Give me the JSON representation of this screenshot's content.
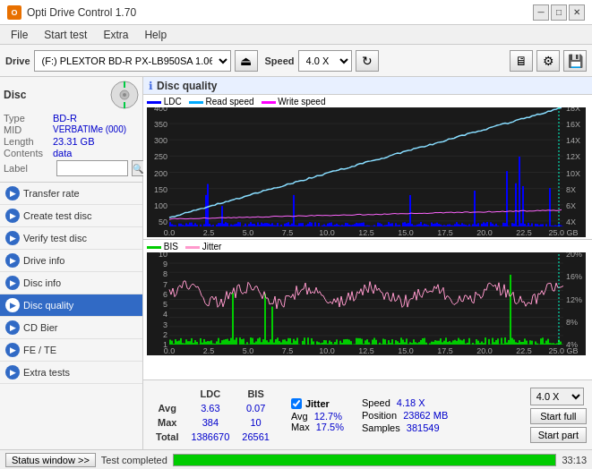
{
  "titleBar": {
    "icon": "O",
    "title": "Opti Drive Control 1.70",
    "minimize": "─",
    "maximize": "□",
    "close": "✕"
  },
  "menuBar": {
    "items": [
      "File",
      "Start test",
      "Extra",
      "Help"
    ]
  },
  "toolbar": {
    "driveLabel": "Drive",
    "driveValue": "(F:)  PLEXTOR BD-R  PX-LB950SA 1.06",
    "speedLabel": "Speed",
    "speedValue": "4.0 X"
  },
  "disc": {
    "title": "Disc",
    "type": {
      "key": "Type",
      "value": "BD-R"
    },
    "mid": {
      "key": "MID",
      "value": "VERBATIMe (000)"
    },
    "length": {
      "key": "Length",
      "value": "23.31 GB"
    },
    "contents": {
      "key": "Contents",
      "value": "data"
    },
    "label": {
      "key": "Label",
      "value": ""
    }
  },
  "navItems": [
    {
      "id": "transfer-rate",
      "label": "Transfer rate",
      "active": false
    },
    {
      "id": "create-test-disc",
      "label": "Create test disc",
      "active": false
    },
    {
      "id": "verify-test-disc",
      "label": "Verify test disc",
      "active": false
    },
    {
      "id": "drive-info",
      "label": "Drive info",
      "active": false
    },
    {
      "id": "disc-info",
      "label": "Disc info",
      "active": false
    },
    {
      "id": "disc-quality",
      "label": "Disc quality",
      "active": true
    },
    {
      "id": "cd-bier",
      "label": "CD Bier",
      "active": false
    },
    {
      "id": "fe-te",
      "label": "FE / TE",
      "active": false
    },
    {
      "id": "extra-tests",
      "label": "Extra tests",
      "active": false
    }
  ],
  "chartTitle": "Disc quality",
  "legend1": {
    "ldc": "LDC",
    "readSpeed": "Read speed",
    "writeSpeed": "Write speed"
  },
  "legend2": {
    "bis": "BIS",
    "jitter": "Jitter"
  },
  "stats": {
    "headers": [
      "LDC",
      "BIS"
    ],
    "avg": {
      "label": "Avg",
      "ldc": "3.63",
      "bis": "0.07"
    },
    "max": {
      "label": "Max",
      "ldc": "384",
      "bis": "10"
    },
    "total": {
      "label": "Total",
      "ldc": "1386670",
      "bis": "26561"
    },
    "jitter": {
      "label": "Jitter",
      "avg": "12.7%",
      "max": "17.5%"
    },
    "speed": {
      "label": "Speed",
      "value": "4.18 X",
      "selectValue": "4.0 X"
    },
    "position": {
      "label": "Position",
      "value": "23862 MB"
    },
    "samples": {
      "label": "Samples",
      "value": "381549"
    },
    "startFull": "Start full",
    "startPart": "Start part"
  },
  "statusBar": {
    "statusWindowBtn": "Status window >>",
    "statusText": "Test completed",
    "progress": 100,
    "time": "33:13"
  },
  "colors": {
    "ldc": "#0000ff",
    "readSpeed": "#00aaff",
    "writeSpeed": "#ff00ff",
    "bis": "#00cc00",
    "jitter": "#ff99cc",
    "accent": "#316ac5"
  }
}
